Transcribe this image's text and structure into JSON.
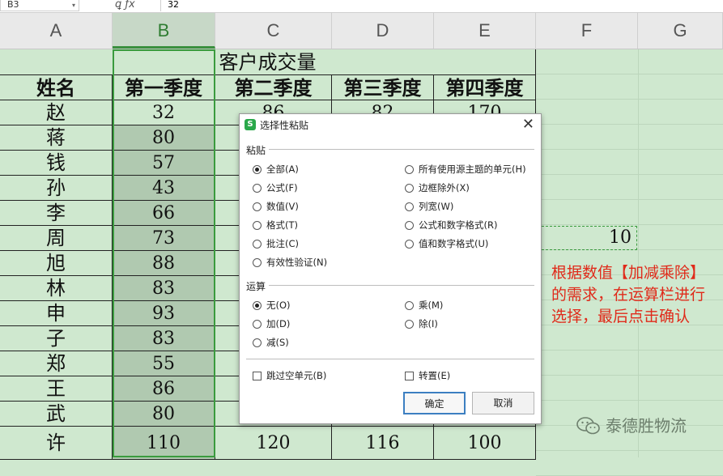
{
  "formula_bar": {
    "cell_ref": "B3",
    "fx_icons": "ꝗ ƒx",
    "value": "32"
  },
  "columns": [
    {
      "label": "A",
      "selected": false
    },
    {
      "label": "B",
      "selected": true
    },
    {
      "label": "C",
      "selected": false
    },
    {
      "label": "D",
      "selected": false
    },
    {
      "label": "E",
      "selected": false
    },
    {
      "label": "F",
      "selected": false
    },
    {
      "label": "G",
      "selected": false
    }
  ],
  "table": {
    "title": "客户成交量",
    "headers": [
      "姓名",
      "第一季度",
      "第二季度",
      "第三季度",
      "第四季度"
    ],
    "rows": [
      {
        "name": "赵",
        "q1": "32",
        "q2": "86",
        "q3": "82",
        "q4": "170"
      },
      {
        "name": "蒋",
        "q1": "80",
        "q2": "",
        "q3": "",
        "q4": ""
      },
      {
        "name": "钱",
        "q1": "57",
        "q2": "",
        "q3": "",
        "q4": ""
      },
      {
        "name": "孙",
        "q1": "43",
        "q2": "",
        "q3": "",
        "q4": ""
      },
      {
        "name": "李",
        "q1": "66",
        "q2": "",
        "q3": "",
        "q4": ""
      },
      {
        "name": "周",
        "q1": "73",
        "q2": "",
        "q3": "",
        "q4": ""
      },
      {
        "name": "旭",
        "q1": "88",
        "q2": "",
        "q3": "",
        "q4": ""
      },
      {
        "name": "林",
        "q1": "83",
        "q2": "",
        "q3": "",
        "q4": ""
      },
      {
        "name": "申",
        "q1": "93",
        "q2": "",
        "q3": "",
        "q4": ""
      },
      {
        "name": "子",
        "q1": "83",
        "q2": "",
        "q3": "",
        "q4": ""
      },
      {
        "name": "郑",
        "q1": "55",
        "q2": "",
        "q3": "",
        "q4": ""
      },
      {
        "name": "王",
        "q1": "86",
        "q2": "",
        "q3": "",
        "q4": ""
      },
      {
        "name": "武",
        "q1": "80",
        "q2": "",
        "q3": "",
        "q4": ""
      },
      {
        "name": "许",
        "q1": "110",
        "q2": "120",
        "q3": "116",
        "q4": "100"
      }
    ]
  },
  "copied_cell": {
    "value": "10"
  },
  "annotation": "根据数值【加减乘除】的需求，在运算栏进行选择，最后点击确认",
  "watermark": "泰德胜物流",
  "dialog": {
    "logo": "S",
    "title": "选择性粘贴",
    "close_symbol": "✕",
    "paste_group_label": "粘贴",
    "paste_options_left": [
      {
        "label": "全部(A)",
        "checked": true
      },
      {
        "label": "公式(F)",
        "checked": false
      },
      {
        "label": "数值(V)",
        "checked": false
      },
      {
        "label": "格式(T)",
        "checked": false
      },
      {
        "label": "批注(C)",
        "checked": false
      },
      {
        "label": "有效性验证(N)",
        "checked": false
      }
    ],
    "paste_options_right": [
      {
        "label": "所有使用源主题的单元(H)",
        "checked": false
      },
      {
        "label": "边框除外(X)",
        "checked": false
      },
      {
        "label": "列宽(W)",
        "checked": false
      },
      {
        "label": "公式和数字格式(R)",
        "checked": false
      },
      {
        "label": "值和数字格式(U)",
        "checked": false
      }
    ],
    "operation_group_label": "运算",
    "operation_options_left": [
      {
        "label": "无(O)",
        "checked": true
      },
      {
        "label": "加(D)",
        "checked": false
      },
      {
        "label": "减(S)",
        "checked": false
      }
    ],
    "operation_options_right": [
      {
        "label": "乘(M)",
        "checked": false
      },
      {
        "label": "除(I)",
        "checked": false
      }
    ],
    "skip_blanks_label": "跳过空单元(B)",
    "skip_blanks_checked": false,
    "transpose_label": "转置(E)",
    "transpose_checked": false,
    "ok_label": "确定",
    "cancel_label": "取消"
  },
  "colors": {
    "sheet_bg": "#cfe8cf",
    "selection": "#3a9b3e",
    "annotation": "#e02a1a",
    "ok_border": "#3c7fc1"
  }
}
